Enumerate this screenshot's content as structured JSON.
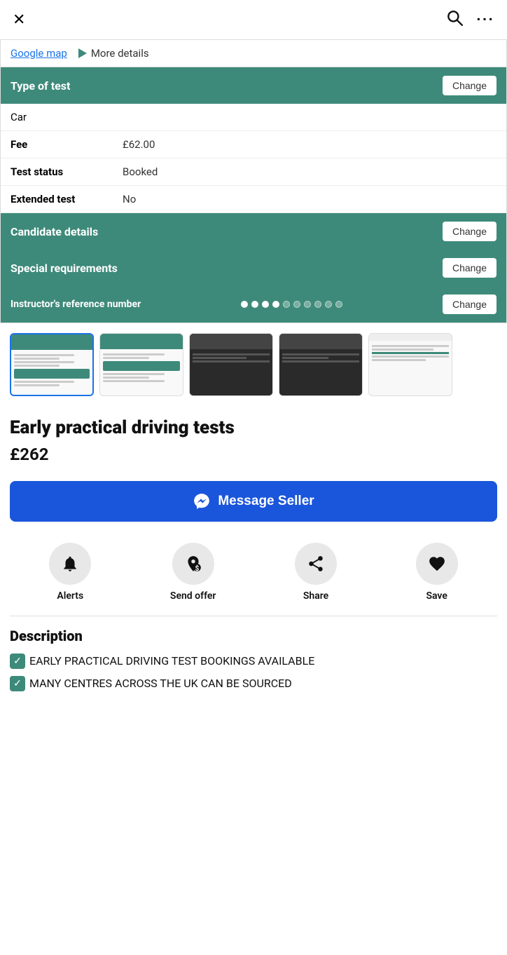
{
  "header": {
    "close_label": "×",
    "search_label": "search",
    "more_label": "more"
  },
  "top_links": {
    "google_map": "Google map",
    "more_details": "More details"
  },
  "test_info": {
    "type_of_test_label": "Type of test",
    "change_label": "Change",
    "car_value": "Car",
    "fee_label": "Fee",
    "fee_value": "£62.00",
    "test_status_label": "Test status",
    "test_status_value": "Booked",
    "extended_test_label": "Extended test",
    "extended_test_value": "No",
    "candidate_details_label": "Candidate details",
    "special_requirements_label": "Special requirements",
    "instructor_ref_label": "Instructor's reference number",
    "instructor_ref_change": "Change"
  },
  "listing": {
    "title": "Early practical driving tests",
    "price": "£262",
    "message_btn": "Message Seller"
  },
  "actions": [
    {
      "id": "alerts",
      "label": "Alerts",
      "icon": "bell"
    },
    {
      "id": "send-offer",
      "label": "Send offer",
      "icon": "send-offer"
    },
    {
      "id": "share",
      "label": "Share",
      "icon": "share"
    },
    {
      "id": "save",
      "label": "Save",
      "icon": "heart"
    }
  ],
  "description": {
    "title": "Description",
    "lines": [
      "EARLY PRACTICAL DRIVING TEST BOOKINGS AVAILABLE",
      "MANY CENTRES ACROSS THE UK CAN BE SOURCED"
    ]
  }
}
